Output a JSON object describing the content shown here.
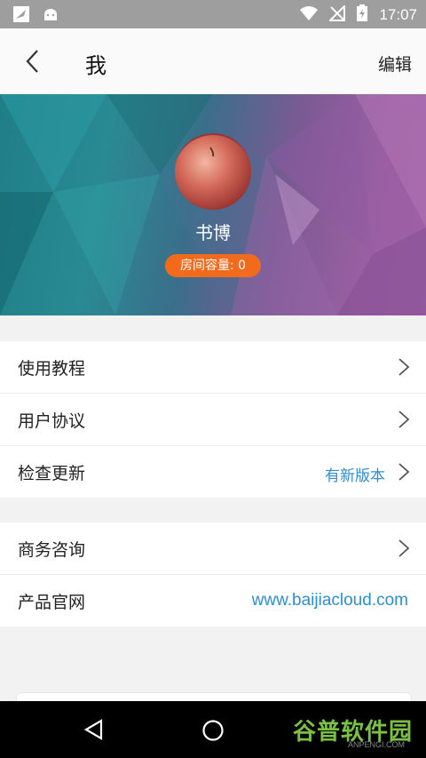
{
  "status_bar": {
    "time": "17:07"
  },
  "header": {
    "title": "我",
    "edit_label": "编辑"
  },
  "profile": {
    "name": "书博",
    "capacity_badge": "房间容量: 0"
  },
  "section1": {
    "items": [
      {
        "label": "使用教程"
      },
      {
        "label": "用户协议"
      },
      {
        "label": "检查更新",
        "value": "有新版本"
      }
    ]
  },
  "section2": {
    "items": [
      {
        "label": "商务咨询"
      },
      {
        "label": "产品官网",
        "value": "www.baijiacloud.com"
      }
    ]
  },
  "watermark": {
    "text": "谷普软件园",
    "sub": "ANPENGI.COM"
  },
  "colors": {
    "accent_blue": "#2b8fd6",
    "badge_orange": "#f26b1d"
  }
}
